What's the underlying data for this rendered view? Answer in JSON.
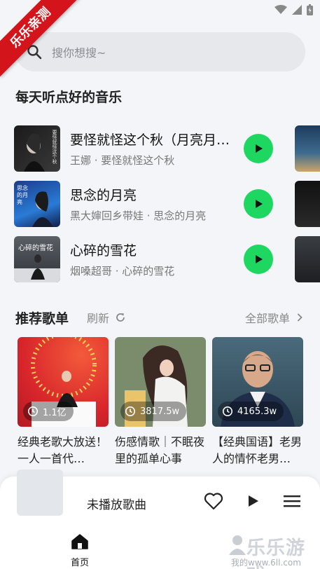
{
  "ribbon": {
    "text": "乐乐亲测"
  },
  "search": {
    "placeholder": "搜你想搜~"
  },
  "daily": {
    "title": "每天听点好的音乐",
    "songs": [
      {
        "title": "要怪就怪这个秋（月亮月…",
        "subtitle": "王娜 · 要怪就怪这个秋"
      },
      {
        "title": "思念的月亮",
        "subtitle": "黑大婶回乡带娃 · 思念的月亮"
      },
      {
        "title": "心碎的雪花",
        "subtitle": "烟嗓超哥 · 心碎的雪花"
      }
    ],
    "covers": [
      {
        "caption": "要怪就怪这个秋"
      },
      {
        "caption": "思念的月亮"
      },
      {
        "caption": "心碎的雪花"
      }
    ]
  },
  "recommend": {
    "title": "推荐歌单",
    "refresh_label": "刷新",
    "all_label": "全部歌单",
    "playlists": [
      {
        "count": "1.1亿",
        "name": "经典老歌大放送！一人一首代…"
      },
      {
        "count": "3817.5w",
        "name": "伤感情歌｜不眠夜里的孤单心事"
      },
      {
        "count": "4165.3w",
        "name": "【经典国语】老男人的情怀老男…"
      }
    ]
  },
  "player": {
    "title": "未播放歌曲"
  },
  "tabs": {
    "home_label": "首页"
  },
  "watermark": {
    "text": "乐乐游戏",
    "url": "我的www.6ll.com"
  },
  "colors": {
    "accent": "#1ed760",
    "ribbon": "#d3141b",
    "background": "#f3f5f8"
  }
}
